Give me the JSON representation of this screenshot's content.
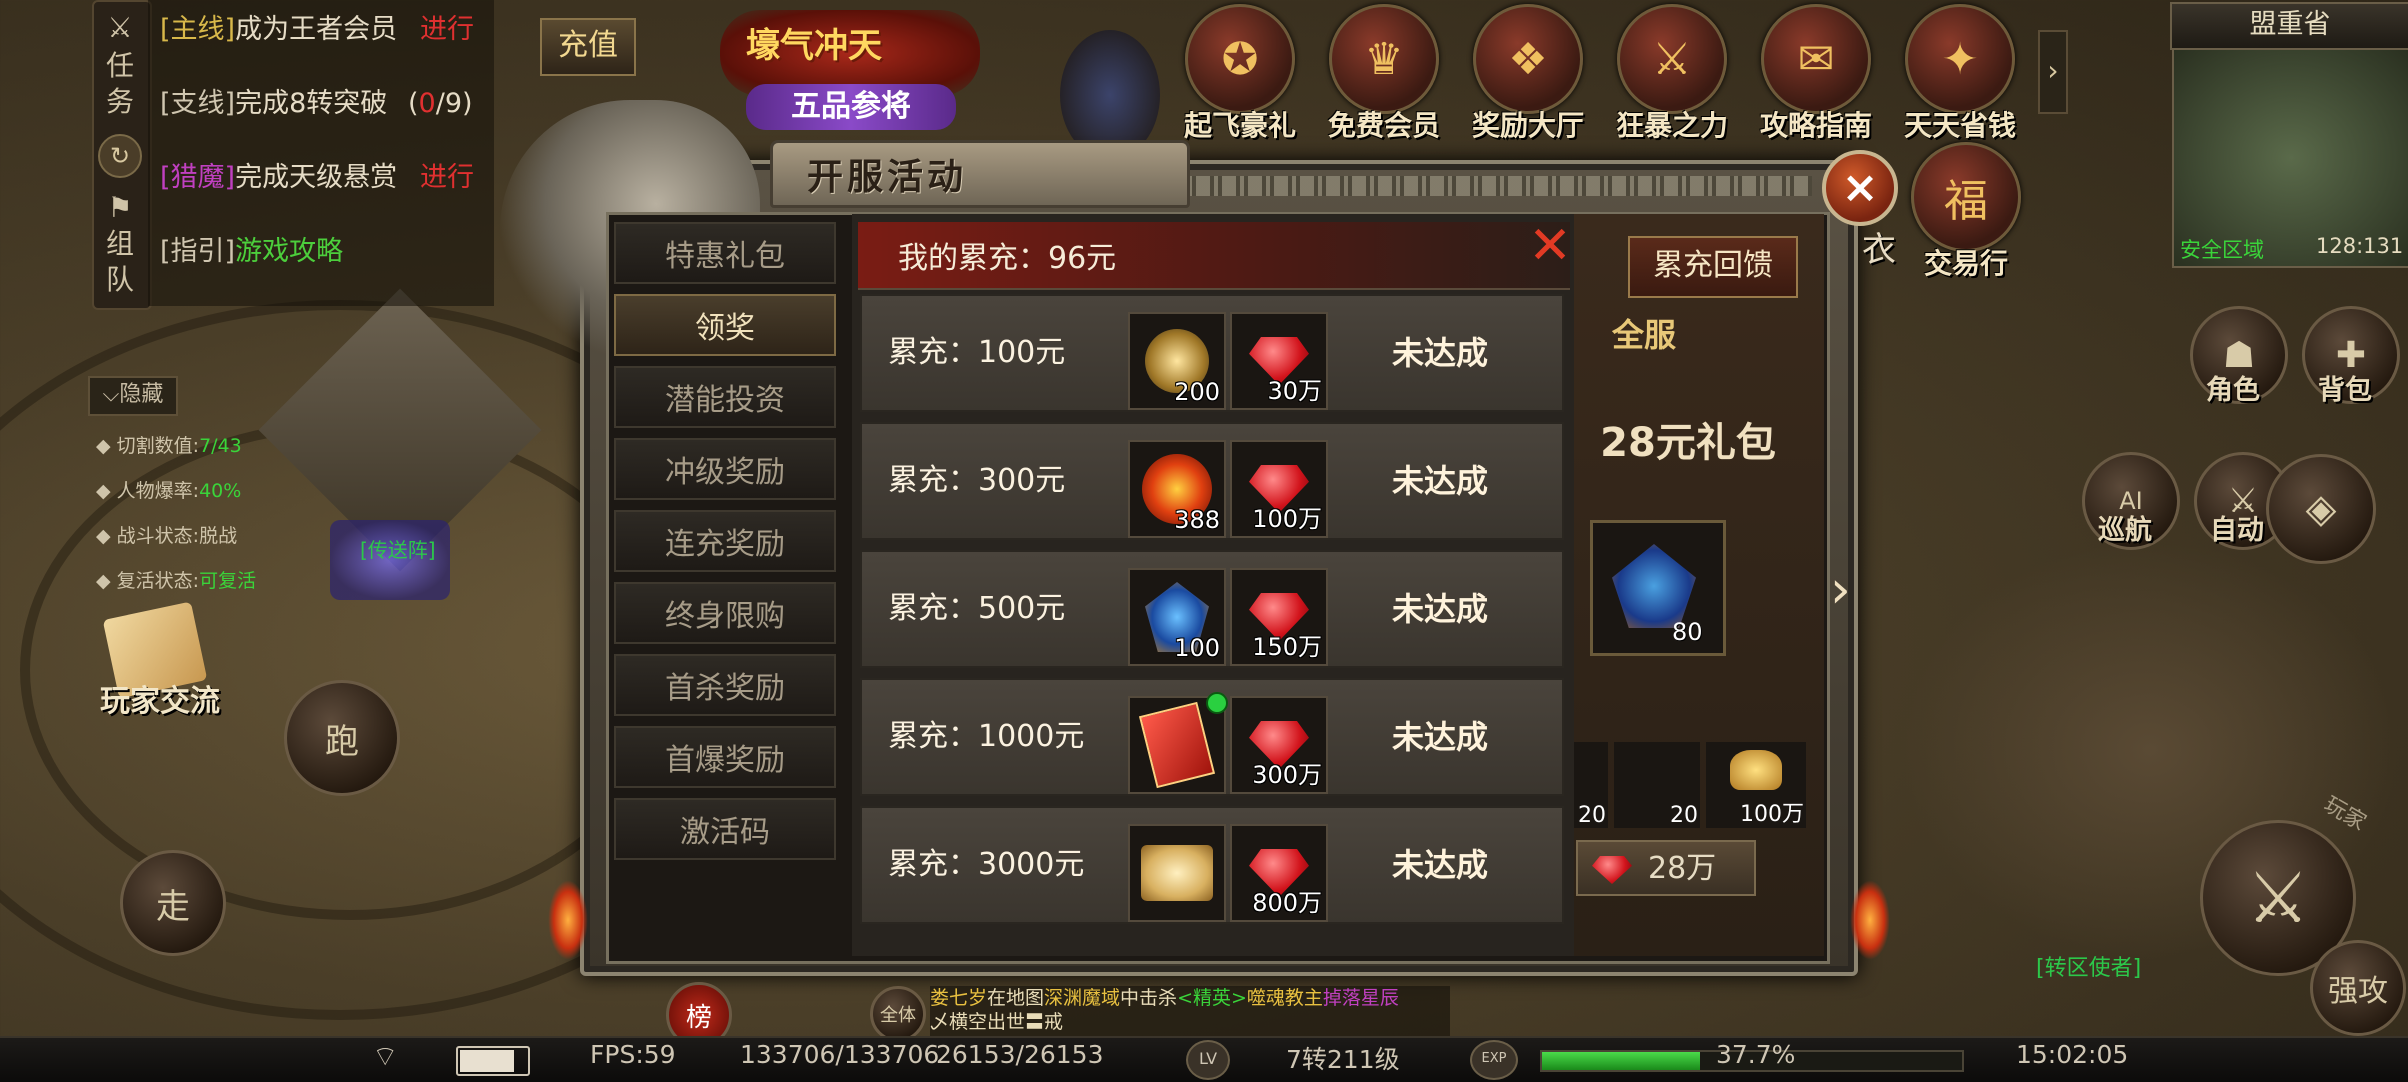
{
  "quests": [
    {
      "tag": "[主线]",
      "text": "成为王者会员",
      "status": "进行",
      "tag_color": "#d8b84a"
    },
    {
      "tag": "[支线]",
      "text": "完成8转突破",
      "status_open": "(",
      "progress_current": "0",
      "status_rest": "/9)",
      "tag_color": "#d0c6b0"
    },
    {
      "tag": "[猎魔]",
      "text": "完成天级悬赏",
      "status": "进行",
      "tag_color": "#c040c0"
    },
    {
      "tag": "[指引]",
      "text": "游戏攻略",
      "tag_color": "#d0c6b0"
    }
  ],
  "quest_side": {
    "task_label": "任务",
    "team_label": "组队"
  },
  "hide_button": "隐藏",
  "player_stats": [
    {
      "label": "切割数值:",
      "value": "7/43"
    },
    {
      "label": "人物爆率:",
      "value": "40%"
    },
    {
      "label": "战斗状态:",
      "value": "脱战"
    },
    {
      "label": "复活状态:",
      "value": "可复活"
    }
  ],
  "player_exchange": "玩家交流",
  "run_button": "跑",
  "walk_button": "走",
  "recharge_button": "充值",
  "banner": {
    "line1": "壕气冲天",
    "line2": "五品参将"
  },
  "top_icons": [
    "起飞豪礼",
    "免费会员",
    "奖励大厅",
    "狂暴之力",
    "攻略指南",
    "天天省钱"
  ],
  "top_icons_row2": [
    "交易行"
  ],
  "minimap": {
    "province": "盟重省",
    "safe_zone": "安全区域",
    "coords": "128:131"
  },
  "right_buttons": [
    "角色",
    "背包",
    "巡航",
    "自动"
  ],
  "ai_label": "AI",
  "dialog": {
    "title": "开服活动",
    "close": "×",
    "menu": [
      "特惠礼包",
      "领奖",
      "潜能投资",
      "冲级奖励",
      "连充奖励",
      "终身限购",
      "首杀奖励",
      "首爆奖励",
      "激活码"
    ],
    "active_menu_index": 1
  },
  "recharge_panel": {
    "header": "我的累充：96元",
    "close": "✕",
    "rows": [
      {
        "amount": "累充：100元",
        "item_count": "200",
        "gem_count": "30万",
        "status": "未达成"
      },
      {
        "amount": "累充：300元",
        "item_count": "388",
        "gem_count": "100万",
        "status": "未达成"
      },
      {
        "amount": "累充：500元",
        "item_count": "100",
        "gem_count": "150万",
        "status": "未达成"
      },
      {
        "amount": "累充：1000元",
        "item_count": "",
        "gem_count": "300万",
        "status": "未达成"
      },
      {
        "amount": "累充：3000元",
        "item_count": "",
        "gem_count": "800万",
        "status": "未达成"
      }
    ]
  },
  "behind_panel": {
    "feedback_button": "累充回馈",
    "server_text": "全服",
    "gift_title": "28元礼包",
    "main_item_count": "80",
    "small_counts": [
      "20",
      "20",
      "100万"
    ],
    "price": "28万",
    "partial_left": "衣"
  },
  "chat": {
    "player": "娄七岁",
    "text1": "在地图",
    "map": "深渊魔域",
    "text2": "中击杀",
    "boss_tag": "<精英>",
    "boss": "噬魂教主",
    "drop": "掉落星辰",
    "line2": "乄横空出世〓戒",
    "channel": "全体"
  },
  "rank_button": "榜",
  "npc_label": "[转区使者]",
  "transport_label": "[传送阵]",
  "bottom_bar": {
    "fps": "FPS:59",
    "hp": "133706/133706",
    "mp": "26153/26153",
    "lv_label": "LV",
    "level": "7转211级",
    "exp_label": "EXP",
    "exp_percent": "37.7%",
    "exp_fraction": 0.377,
    "time": "15:02:05"
  },
  "attack_labels": {
    "play": "玩家",
    "strong": "强攻"
  },
  "colors": {
    "accent_red": "#d2141c",
    "quest_progress": "#e03030",
    "safe_green": "#3ad43a"
  }
}
